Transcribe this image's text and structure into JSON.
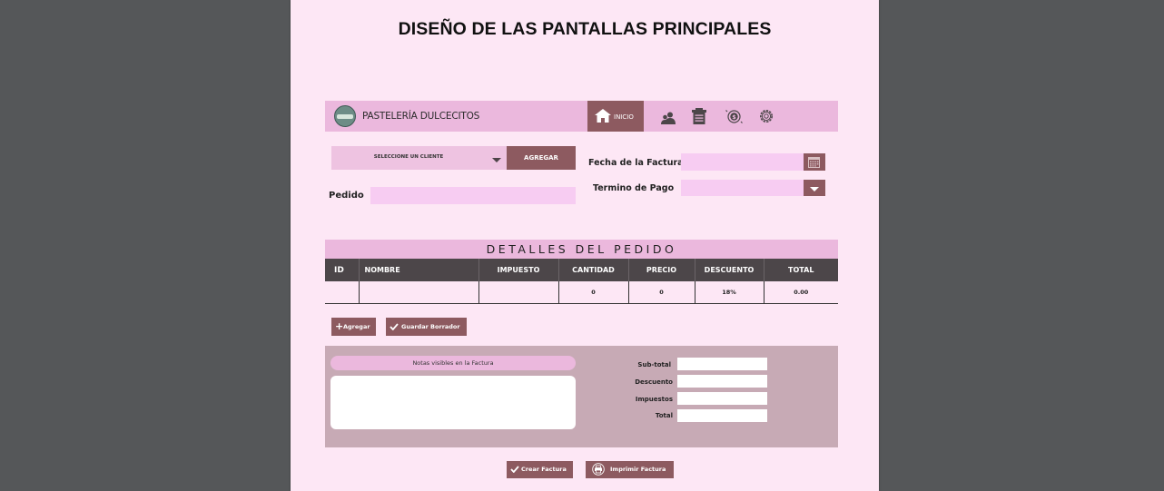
{
  "title": "DISEÑO DE LAS PANTALLAS PRINCIPALES",
  "navbar": {
    "brand": "PASTELERÍA DULCECITOS",
    "inicio_label": "INICIO",
    "icons": [
      "home-icon",
      "customers-icon",
      "inventory-icon",
      "billing-icon",
      "settings-icon"
    ]
  },
  "form": {
    "client_select": "SELECCIONE UN CLIENTE",
    "add_button": "AGREGAR",
    "invoice_date_label": "Fecha de la Factura",
    "invoice_date_value": "",
    "order_label": "Pedido",
    "order_value": "",
    "payment_term_label": "Termino de Pago",
    "payment_term_value": ""
  },
  "details": {
    "title": "DETALLES DEL PEDIDO",
    "columns": [
      "ID",
      "NOMBRE",
      "IMPUESTO",
      "CANTIDAD",
      "PRECIO",
      "DESCUENTO",
      "TOTAL"
    ],
    "rows": [
      [
        "",
        "",
        "",
        "0",
        "0",
        "18%",
        "0.00"
      ]
    ],
    "add_label": "Agregar",
    "save_draft_label": "Guardar Borrador"
  },
  "notes": {
    "label": "Notas visibles en la Factura",
    "value": ""
  },
  "totals": {
    "subtotal_label": "Sub-total",
    "discount_label": "Descuento",
    "taxes_label": "Impuestos",
    "total_label": "Total"
  },
  "actions": {
    "create_label": "Crear Factura",
    "print_label": "Imprimir Factura"
  },
  "colors": {
    "page_bg": "#fde7f5",
    "accent": "#8d5a60",
    "pink_bar": "#ebb8dd",
    "table_header": "#4c4649",
    "panel": "#c7aab5"
  }
}
